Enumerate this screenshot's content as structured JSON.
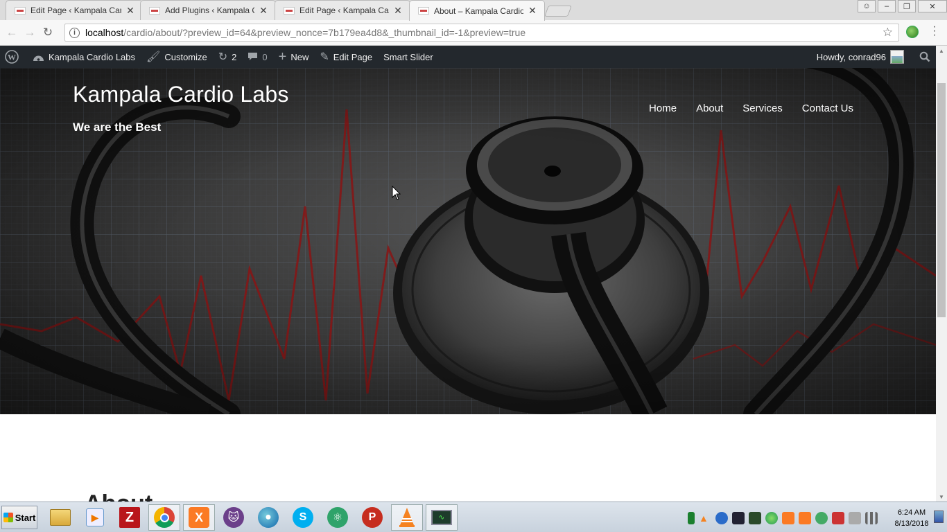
{
  "browser": {
    "tabs": [
      {
        "title": "Edit Page ‹ Kampala Cardio",
        "active": false
      },
      {
        "title": "Add Plugins ‹ Kampala Card",
        "active": false
      },
      {
        "title": "Edit Page ‹ Kampala Cardio",
        "active": false
      },
      {
        "title": "About – Kampala Cardio La",
        "active": true
      }
    ],
    "url_host": "localhost",
    "url_path": "/cardio/about/?preview_id=64&preview_nonce=7b179ea4d8&_thumbnail_id=-1&preview=true"
  },
  "adminbar": {
    "site_name": "Kampala Cardio Labs",
    "customize": "Customize",
    "updates_count": "2",
    "comments_count": "0",
    "new": "New",
    "edit_page": "Edit Page",
    "smart_slider": "Smart Slider",
    "howdy": "Howdy, conrad96"
  },
  "site": {
    "title": "Kampala Cardio Labs",
    "description": "We are the Best",
    "nav": [
      "Home",
      "About",
      "Services",
      "Contact Us"
    ]
  },
  "content": {
    "heading": "About"
  },
  "taskbar": {
    "start": "Start",
    "time": "6:24 AM",
    "date": "8/13/2018"
  },
  "colors": {
    "adminbar_bg": "#23282d",
    "ecg_line": "#8a1414",
    "hero_dark": "#262626"
  }
}
